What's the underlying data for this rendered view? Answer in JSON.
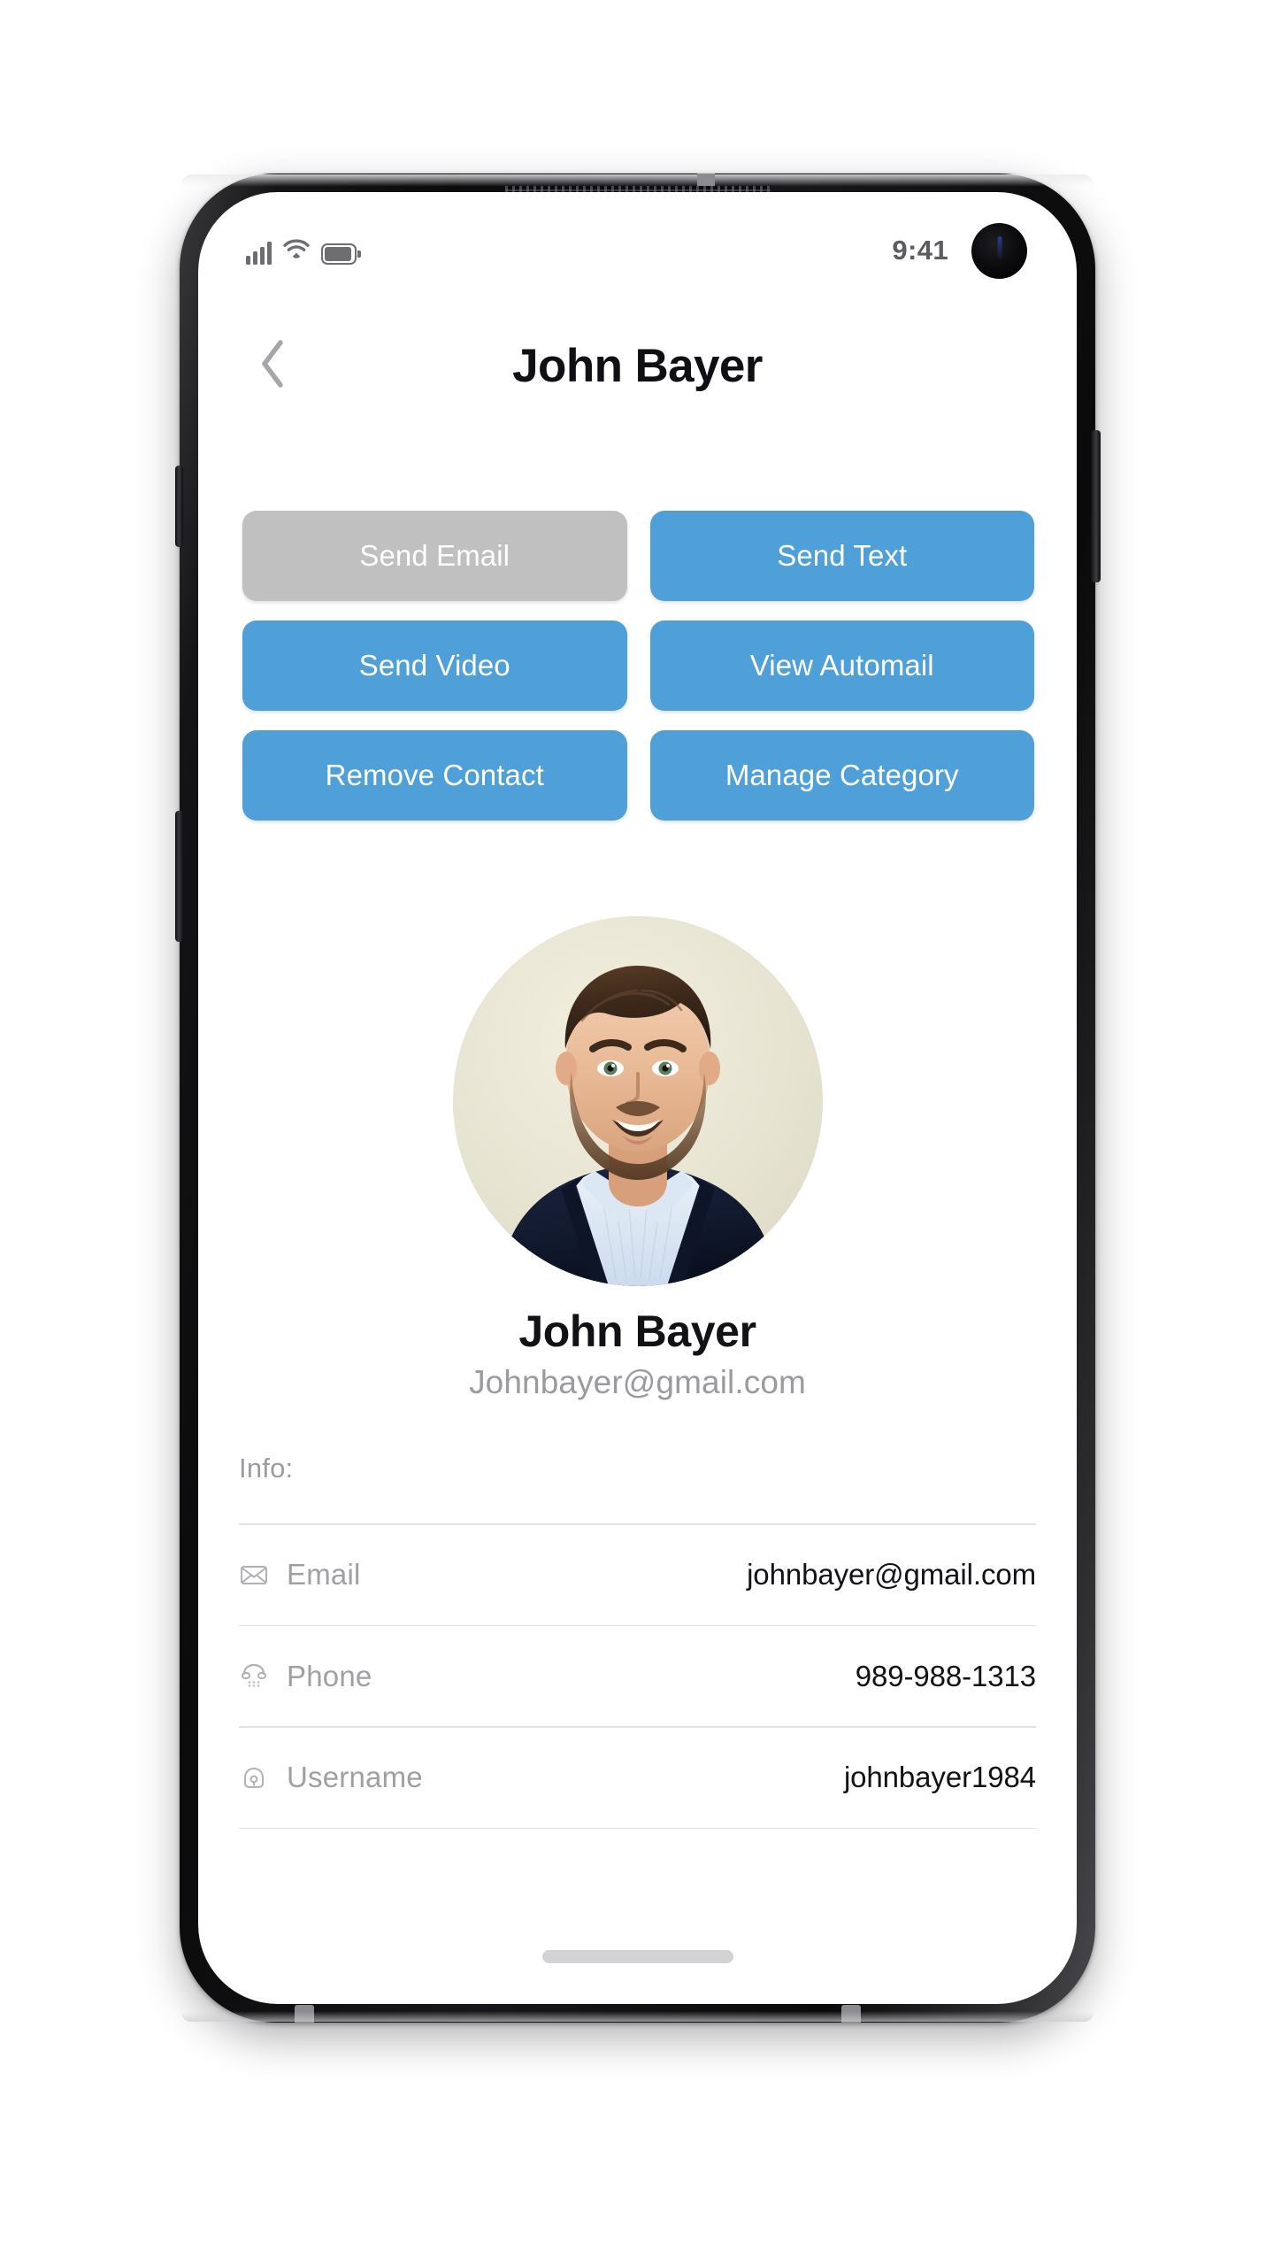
{
  "statusbar": {
    "time": "9:41",
    "icons": [
      "signal-bars-icon",
      "wifi-icon",
      "battery-icon",
      "front-camera-punch-hole"
    ]
  },
  "header": {
    "back_icon": "chevron-left-icon",
    "title": "John Bayer"
  },
  "actions": [
    {
      "label": "Send Email",
      "state": "disabled",
      "name": "send-email-button"
    },
    {
      "label": "Send Text",
      "state": "primary",
      "name": "send-text-button"
    },
    {
      "label": "Send Video",
      "state": "primary",
      "name": "send-video-button"
    },
    {
      "label": "View Automail",
      "state": "primary",
      "name": "view-automail-button"
    },
    {
      "label": "Remove Contact",
      "state": "primary",
      "name": "remove-contact-button"
    },
    {
      "label": "Manage Category",
      "state": "primary",
      "name": "manage-category-button"
    }
  ],
  "profile": {
    "avatar_alt": "contact-profile-photo",
    "name": "John Bayer",
    "email": "Johnbayer@gmail.com"
  },
  "info": {
    "section_label": "Info:",
    "rows": [
      {
        "icon": "envelope-icon",
        "key": "Email",
        "value": "johnbayer@gmail.com"
      },
      {
        "icon": "telephone-icon",
        "key": "Phone",
        "value": "989-988-1313"
      },
      {
        "icon": "lock-icon",
        "key": "Username",
        "value": "johnbayer1984"
      }
    ]
  },
  "colors": {
    "primary_blue": "#4F9FD8",
    "disabled_gray": "#C0C0C0",
    "muted_text": "#9C9CA0",
    "value_text": "#121216",
    "divider": "#E2E2E4"
  }
}
